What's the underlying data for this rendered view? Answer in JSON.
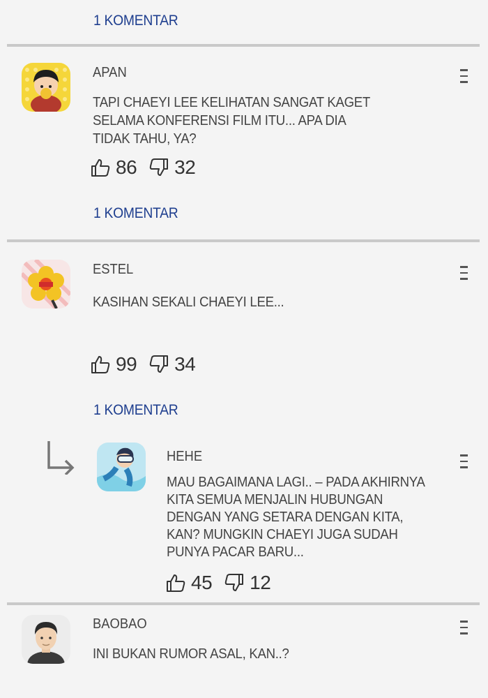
{
  "comments": [
    {
      "username": "APAN",
      "text": [
        "TAPI CHAEYI LEE KELIHATAN SANGAT KAGET",
        "SELAMA KONFERENSI FILM ITU... APA DIA",
        "TIDAK TAHU, YA?"
      ],
      "likes": "86",
      "dislikes": "32",
      "reply_link": "1 KOMENTAR"
    },
    {
      "username": "ESTEL",
      "text": [
        "KASIHAN SEKALI CHAEYI LEE..."
      ],
      "likes": "99",
      "dislikes": "34",
      "reply_link": "1 KOMENTAR"
    },
    {
      "username": "BAOBAO",
      "text": [
        "INI BUKAN RUMOR ASAL, KAN..?"
      ]
    }
  ],
  "top_reply_link": "1 KOMENTAR",
  "reply": {
    "username": "HEHE",
    "text": [
      "MAU BAGAIMANA LAGI.. – PADA AKHIRNYA",
      "KITA SEMUA MENJALIN HUBUNGAN",
      "DENGAN YANG SETARA DENGAN KITA,",
      "KAN? MUNGKIN CHAEYI JUGA SUDAH",
      "PUNYA PACAR BARU..."
    ],
    "likes": "45",
    "dislikes": "12"
  },
  "icons": {
    "like": "thumbs-up-icon",
    "dislike": "thumbs-down-icon",
    "menu": "more-menu-icon",
    "reply": "reply-arrow-icon"
  },
  "colors": {
    "link": "#1f3f8f",
    "divider": "#c9c9c9",
    "background": "#f4f4f4"
  }
}
